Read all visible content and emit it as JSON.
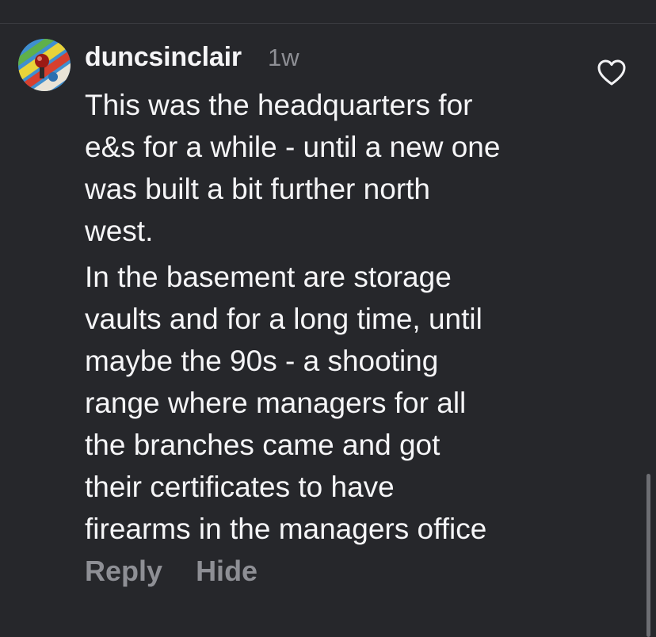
{
  "comment": {
    "username": "duncsinclair",
    "timestamp": "1w",
    "avatar_icon": "user-avatar",
    "like_icon": "heart-outline-icon",
    "paragraphs": [
      {
        "lines": [
          "This was the headquarters for",
          "e&s for a while - until a new one",
          "was built a bit further north",
          "west."
        ]
      },
      {
        "lines": [
          "In the basement are storage",
          "vaults and for a long time, until",
          "maybe the 90s - a shooting",
          "range where managers for all",
          "the branches came and got",
          "their certificates to have",
          "firearms in the managers office"
        ]
      }
    ],
    "actions": {
      "reply_label": "Reply",
      "hide_label": "Hide"
    }
  },
  "colors": {
    "background": "#26272b",
    "primary_text": "#f5f5f7",
    "secondary_text": "#8e8f95"
  }
}
